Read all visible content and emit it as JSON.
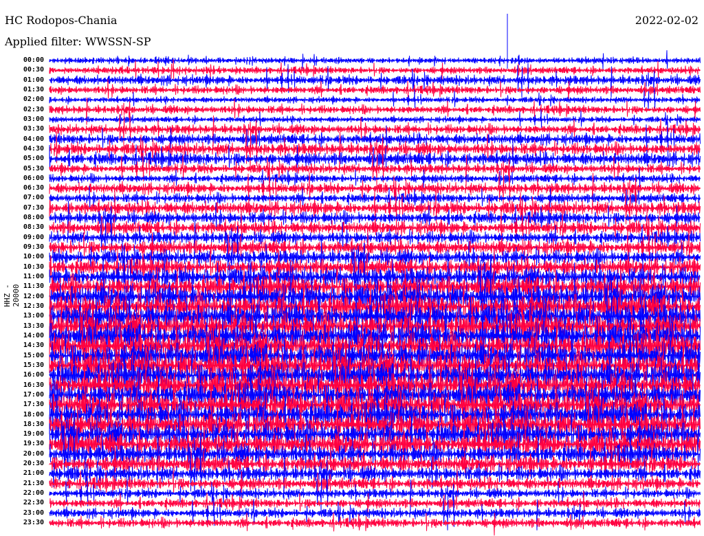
{
  "header": {
    "station": "HC Rodopos-Chania",
    "filter": "Applied filter: WWSSN-SP",
    "date": "2022-02-02"
  },
  "chart_data": {
    "type": "line",
    "title": "HC Rodopos-Chania",
    "ylabel": "HHZ - 20000",
    "colors": [
      "#0000ff",
      "#ff0040"
    ],
    "row_labels": [
      "00:00",
      "00:30",
      "01:00",
      "01:30",
      "02:00",
      "02:30",
      "03:00",
      "03:30",
      "04:00",
      "04:30",
      "05:00",
      "05:30",
      "06:00",
      "06:30",
      "07:00",
      "07:30",
      "08:00",
      "08:30",
      "09:00",
      "09:30",
      "10:00",
      "10:30",
      "11:00",
      "11:30",
      "12:00",
      "12:30",
      "13:00",
      "13:30",
      "14:00",
      "14:30",
      "15:00",
      "15:30",
      "16:00",
      "16:30",
      "17:00",
      "17:30",
      "18:00",
      "18:30",
      "19:00",
      "19:30",
      "20:00",
      "20:30",
      "21:00",
      "21:30",
      "22:00",
      "22:30",
      "23:00",
      "23:30"
    ],
    "relative_amplitude": [
      0.15,
      0.2,
      0.3,
      0.25,
      0.15,
      0.25,
      0.15,
      0.3,
      0.35,
      0.4,
      0.45,
      0.3,
      0.25,
      0.35,
      0.3,
      0.45,
      0.4,
      0.45,
      0.4,
      0.5,
      0.5,
      0.6,
      0.7,
      0.8,
      0.9,
      0.95,
      1.0,
      1.0,
      1.0,
      1.0,
      1.0,
      1.0,
      1.0,
      1.0,
      0.95,
      0.95,
      0.95,
      0.9,
      0.9,
      0.85,
      0.7,
      0.6,
      0.5,
      0.4,
      0.3,
      0.3,
      0.3,
      0.3
    ]
  }
}
